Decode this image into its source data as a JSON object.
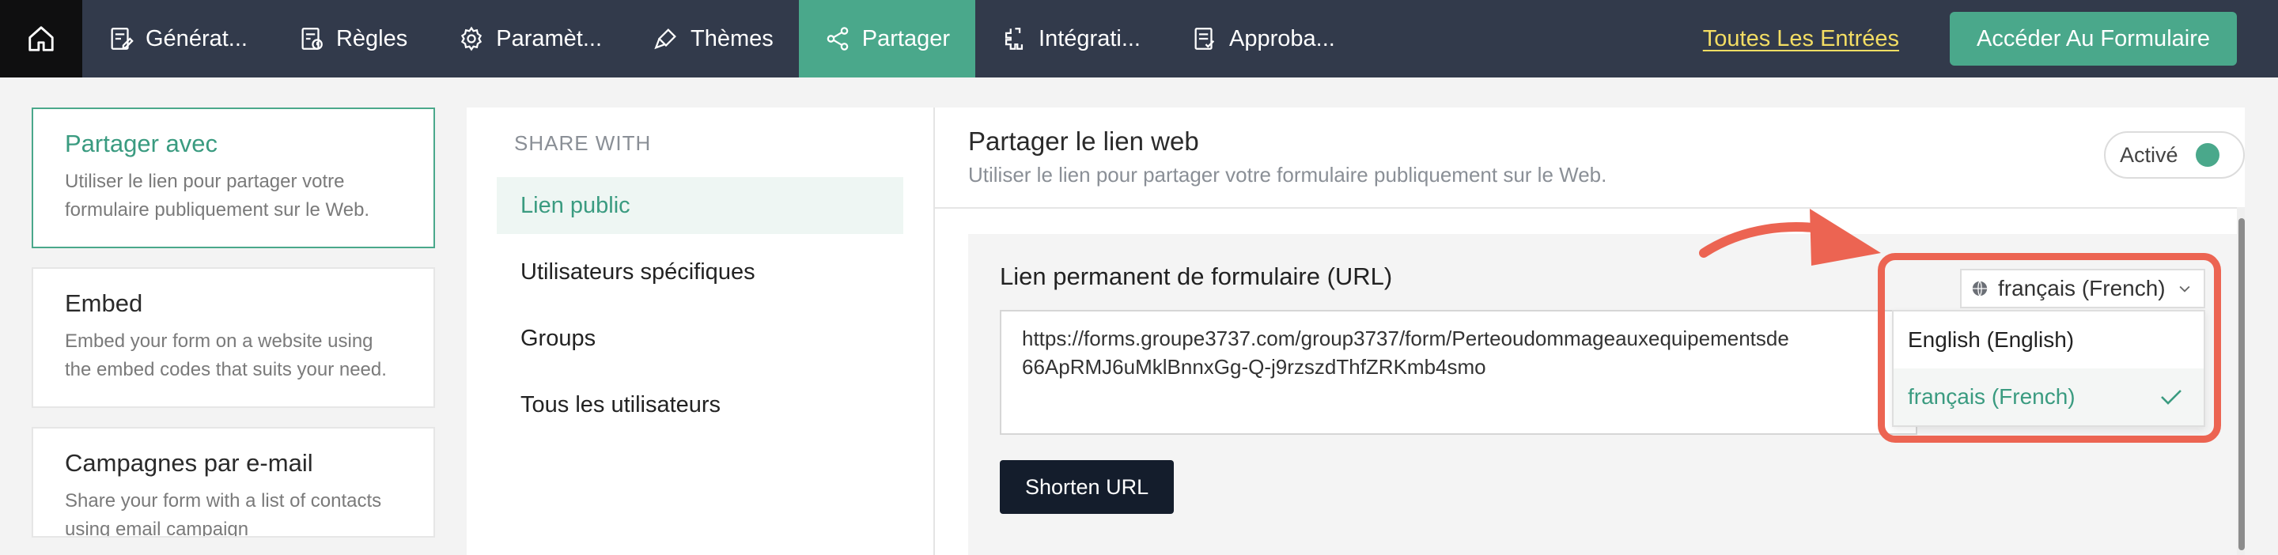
{
  "topbar": {
    "tabs": [
      {
        "label": "Générat...",
        "icon": "form-edit-icon"
      },
      {
        "label": "Règles",
        "icon": "rules-icon"
      },
      {
        "label": "Paramèt...",
        "icon": "gear-icon"
      },
      {
        "label": "Thèmes",
        "icon": "paint-brush-icon"
      },
      {
        "label": "Partager",
        "icon": "share-icon",
        "active": true
      },
      {
        "label": "Intégrati...",
        "icon": "integration-icon"
      },
      {
        "label": "Approba...",
        "icon": "approval-icon"
      }
    ],
    "entries_link": "Toutes Les Entrées",
    "open_form_button": "Accéder Au Formulaire"
  },
  "left": {
    "cards": [
      {
        "title": "Partager avec",
        "desc": "Utiliser le lien pour partager votre formulaire publiquement sur le Web.",
        "active": true
      },
      {
        "title": "Embed",
        "desc": "Embed your form on a website using the embed codes that suits your need."
      },
      {
        "title": "Campagnes par e-mail",
        "desc": "Share your form with a list of contacts using email campaign"
      }
    ]
  },
  "middle": {
    "heading": "SHARE WITH",
    "items": [
      {
        "label": "Lien public",
        "active": true
      },
      {
        "label": "Utilisateurs spécifiques"
      },
      {
        "label": "Groups"
      },
      {
        "label": "Tous les utilisateurs"
      }
    ]
  },
  "panel": {
    "title": "Partager le lien web",
    "subtitle": "Utiliser le lien pour partager votre formulaire publiquement sur le Web.",
    "toggle_label": "Activé",
    "url_label": "Lien permanent de formulaire (URL)",
    "url_value": "https://forms.groupe3737.com/group3737/form/Perteoudommageauxequipementsde 66ApRMJ6uMklBnnxGg-Q-j9rzszdThfZRKmb4smo",
    "shorten_button": "Shorten URL",
    "language": {
      "selected": "français (French)",
      "options": [
        "English (English)",
        "français (French)"
      ]
    }
  },
  "colors": {
    "topbar": "#323a4b",
    "accent": "#4aa88b",
    "annotation": "#ec6452",
    "link": "#f3dd63"
  }
}
